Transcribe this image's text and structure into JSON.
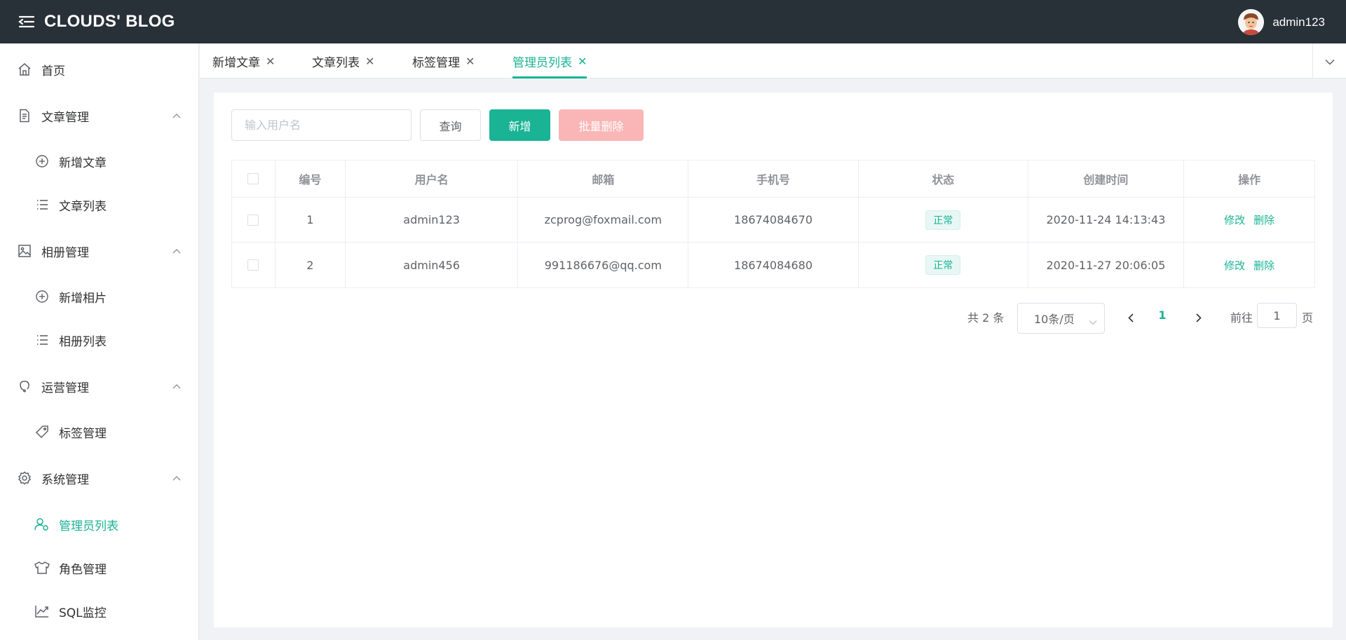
{
  "header": {
    "brand": "CLOUDS' BLOG",
    "username": "admin123"
  },
  "sidebar": {
    "items": [
      {
        "label": "首页",
        "icon": "home-icon"
      },
      {
        "label": "文章管理",
        "icon": "document-icon"
      },
      {
        "label": "新增文章",
        "icon": "plus-circle-icon"
      },
      {
        "label": "文章列表",
        "icon": "list-icon"
      },
      {
        "label": "相册管理",
        "icon": "picture-icon"
      },
      {
        "label": "新增相片",
        "icon": "plus-circle-icon"
      },
      {
        "label": "相册列表",
        "icon": "list-icon"
      },
      {
        "label": "运营管理",
        "icon": "operations-icon"
      },
      {
        "label": "标签管理",
        "icon": "tag-icon"
      },
      {
        "label": "系统管理",
        "icon": "gear-icon"
      },
      {
        "label": "管理员列表",
        "icon": "user-icon"
      },
      {
        "label": "角色管理",
        "icon": "shirt-icon"
      },
      {
        "label": "SQL监控",
        "icon": "trend-chart-icon"
      }
    ]
  },
  "tabs": [
    {
      "label": "新增文章"
    },
    {
      "label": "文章列表"
    },
    {
      "label": "标签管理"
    },
    {
      "label": "管理员列表"
    }
  ],
  "toolbar": {
    "search_placeholder": "输入用户名",
    "query_label": "查询",
    "add_label": "新增",
    "batch_delete_label": "批量删除"
  },
  "table": {
    "headers": [
      "编号",
      "用户名",
      "邮箱",
      "手机号",
      "状态",
      "创建时间",
      "操作"
    ],
    "rows": [
      {
        "id": "1",
        "username": "admin123",
        "email": "zcprog@foxmail.com",
        "phone": "18674084670",
        "status": "正常",
        "created": "2020-11-24 14:13:43",
        "edit": "修改",
        "delete": "删除"
      },
      {
        "id": "2",
        "username": "admin456",
        "email": "991186676@qq.com",
        "phone": "18674084680",
        "status": "正常",
        "created": "2020-11-27 20:06:05",
        "edit": "修改",
        "delete": "删除"
      }
    ]
  },
  "pagination": {
    "total": "共 2 条",
    "page_size": "10条/页",
    "current_page": "1",
    "goto_label": "前往",
    "goto_value": "1",
    "page_suffix": "页"
  },
  "colors": {
    "accent": "#1ab394",
    "header_bg": "#283038",
    "danger_disabled": "#fab6b6"
  }
}
